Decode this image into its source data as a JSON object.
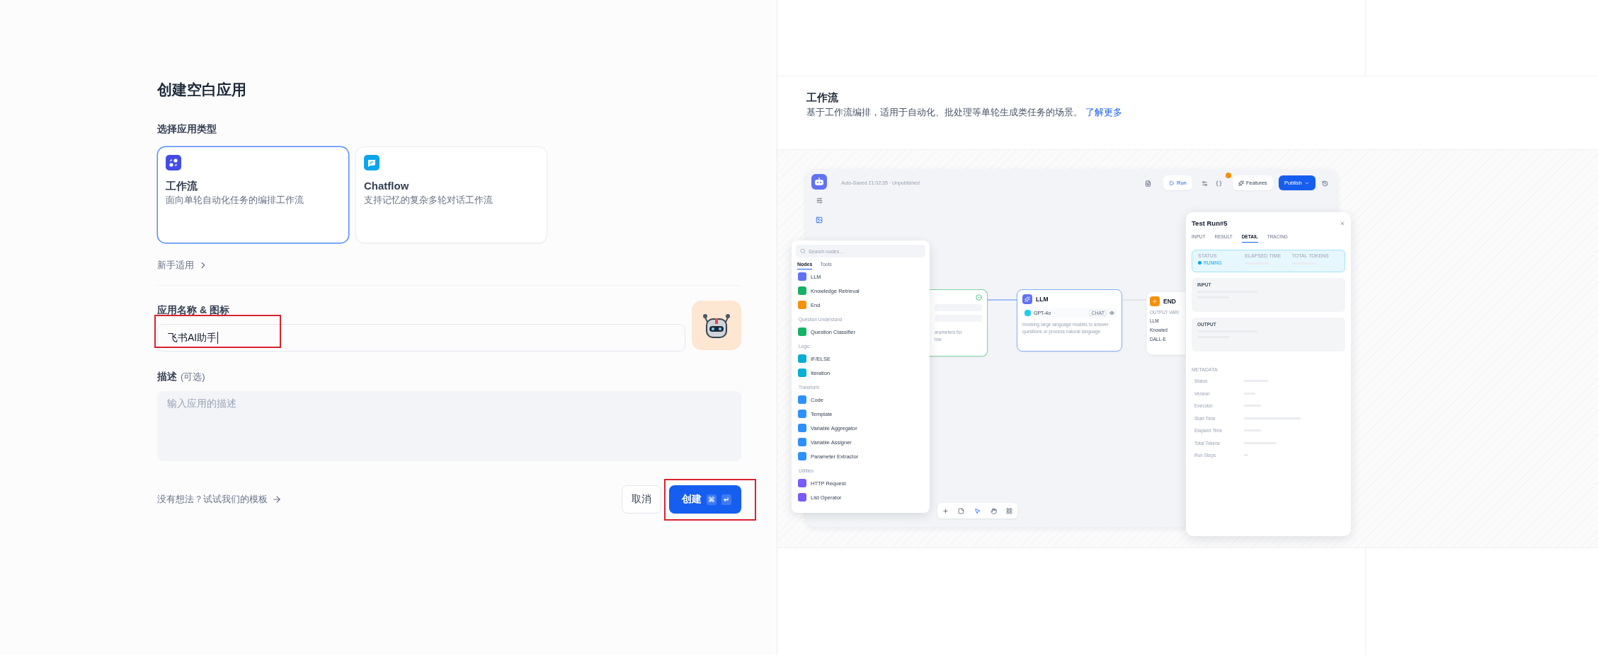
{
  "dialog": {
    "title": "创建空白应用"
  },
  "app_type": {
    "label": "选择应用类型",
    "options": [
      {
        "kind": "workflow",
        "title": "工作流",
        "description": "面向单轮自动化任务的编排工作流",
        "selected": true
      },
      {
        "kind": "chatflow",
        "title": "Chatflow",
        "description": "支持记忆的复杂多轮对话工作流",
        "selected": false
      }
    ],
    "beginner_link": "新手适用"
  },
  "name_field": {
    "label": "应用名称 & 图标",
    "value": "飞书AI助手",
    "highlighted": true
  },
  "description_field": {
    "label": "描述",
    "optional": "(可选)",
    "placeholder": "输入应用的描述"
  },
  "template_link": "没有想法？试试我们的模板",
  "buttons": [
    {
      "kind": "cancel",
      "label": "取消"
    },
    {
      "kind": "create",
      "label": "创建",
      "keys": [
        "⌘",
        "↵"
      ],
      "highlighted": true
    }
  ],
  "preview": {
    "title": "工作流",
    "description": "基于工作流编排，适用于自动化、批处理等单轮生成类任务的场景。",
    "link": "了解更多",
    "editor": {
      "status": "Auto-Saved 21:02:35 · Unpublished",
      "run": "Run",
      "features": "Features",
      "publish": "Publish",
      "node_panel": {
        "search_placeholder": "Search nodes...",
        "tabs": [
          {
            "label": "Nodes",
            "selected": true
          },
          {
            "label": "Tools",
            "selected": false
          }
        ],
        "groups": [
          {
            "items": [
              {
                "label": "LLM",
                "color": "#6172f3"
              },
              {
                "label": "Knowledge Retrieval",
                "color": "#16b364"
              },
              {
                "label": "End",
                "color": "#f79009"
              }
            ]
          },
          {
            "title": "Question Understand",
            "items": [
              {
                "label": "Question Classifier",
                "color": "#16b364"
              }
            ]
          },
          {
            "title": "Logic",
            "items": [
              {
                "label": "IF/ELSE",
                "color": "#06aed4"
              },
              {
                "label": "Iteration",
                "color": "#06aed4"
              }
            ]
          },
          {
            "title": "Transform",
            "items": [
              {
                "label": "Code",
                "color": "#2e90fa"
              },
              {
                "label": "Template",
                "color": "#2e90fa"
              },
              {
                "label": "Variable Aggregator",
                "color": "#2e90fa"
              },
              {
                "label": "Variable Assigner",
                "color": "#2e90fa"
              },
              {
                "label": "Parameter Extractor",
                "color": "#2e90fa"
              }
            ]
          },
          {
            "title": "Utilities",
            "items": [
              {
                "label": "HTTP Request",
                "color": "#7a5af8"
              },
              {
                "label": "List Operator",
                "color": "#7a5af8"
              }
            ]
          }
        ]
      },
      "start_node": {
        "description_lines": [
          "arameters for",
          "low"
        ]
      },
      "llm_node": {
        "title": "LLM",
        "model": "GPT-4o",
        "mode": "CHAT",
        "description": "Invoking large language models to answer questions or process natural language"
      },
      "end_node": {
        "title": "END",
        "outputs_label": "OUTPUT VARI",
        "outputs": [
          "LLM",
          "Knowled",
          "DALL-E"
        ]
      },
      "test_run": {
        "title": "Test Run#5",
        "tabs": [
          {
            "label": "INPUT",
            "selected": false
          },
          {
            "label": "RESULT",
            "selected": false
          },
          {
            "label": "DETAIL",
            "selected": true
          },
          {
            "label": "TRACING",
            "selected": false
          }
        ],
        "summary": [
          {
            "label": "STATUS",
            "value": "RUNING"
          },
          {
            "label": "ELAPSED TIME"
          },
          {
            "label": "TOTAL TOKENS"
          }
        ],
        "sections": [
          "INPUT",
          "OUTPUT"
        ],
        "metadata_title": "METADATA",
        "metadata": [
          "Status",
          "Version",
          "Executor",
          "Start Time",
          "Elapsed Time",
          "Total Tokens",
          "Run Steps"
        ]
      }
    }
  }
}
